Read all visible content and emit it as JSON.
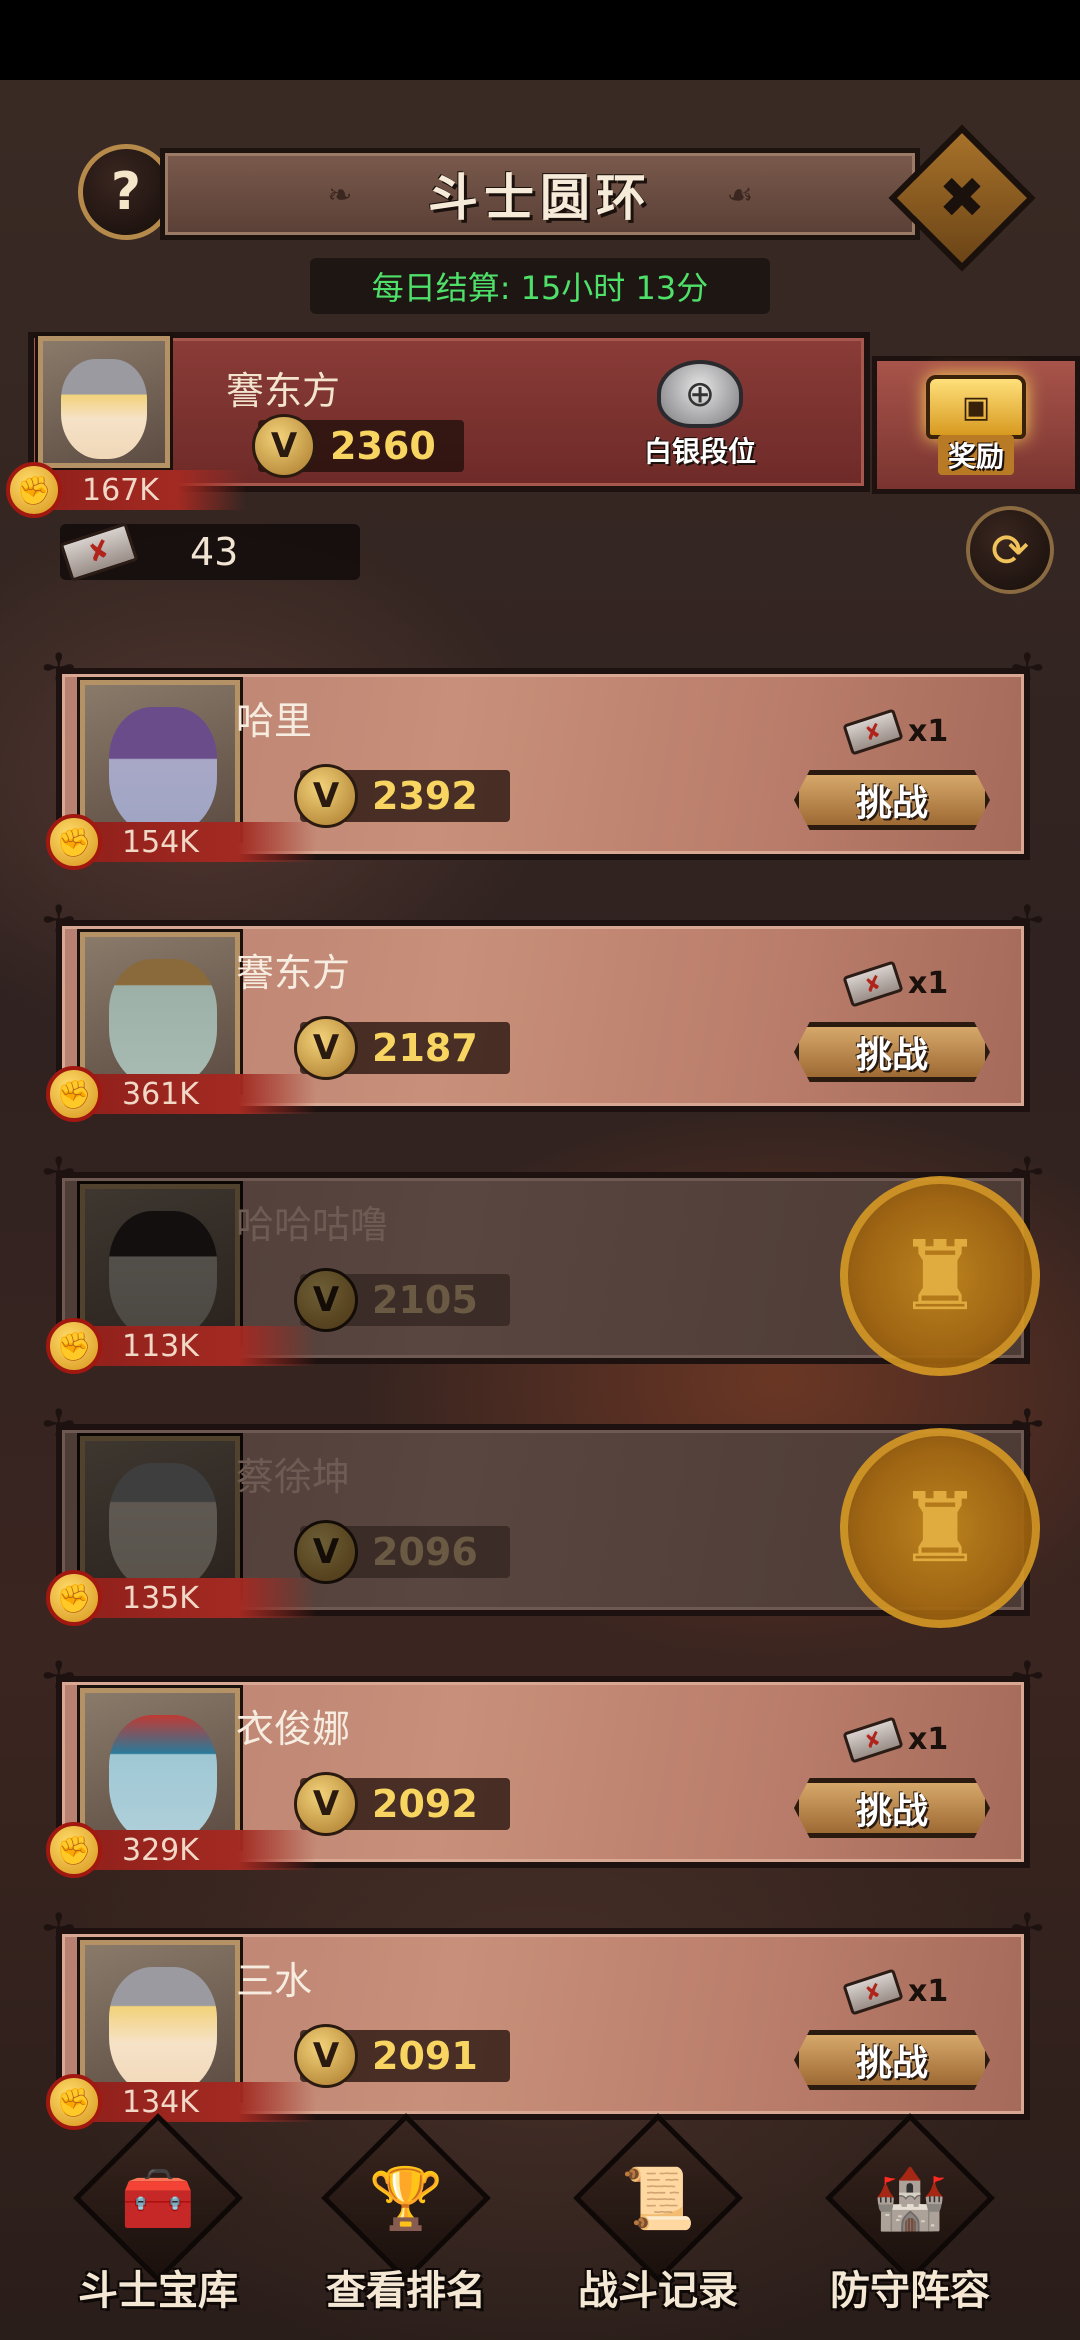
{
  "header": {
    "title": "斗士圆环",
    "help_icon": "?",
    "close_icon": "✖"
  },
  "settlement": {
    "label": "每日结算:",
    "value": "15小时 13分"
  },
  "player": {
    "name": "謇东方",
    "score": "2360",
    "power": "167K",
    "rank_label": "白银段位",
    "reward_label": "奖励",
    "tickets": "43"
  },
  "opponents": [
    {
      "name": "哈里",
      "score": "2392",
      "power": "154K",
      "cost": "x1",
      "action": "挑战",
      "defeated": false
    },
    {
      "name": "謇东方",
      "score": "2187",
      "power": "361K",
      "cost": "x1",
      "action": "挑战",
      "defeated": false
    },
    {
      "name": "哈哈咕噜",
      "score": "2105",
      "power": "113K",
      "defeated": true
    },
    {
      "name": "蔡徐坤",
      "score": "2096",
      "power": "135K",
      "defeated": true
    },
    {
      "name": "衣俊娜",
      "score": "2092",
      "power": "329K",
      "cost": "x1",
      "action": "挑战",
      "defeated": false
    },
    {
      "name": "三水",
      "score": "2091",
      "power": "134K",
      "cost": "x1",
      "action": "挑战",
      "defeated": false
    }
  ],
  "nav": [
    {
      "label": "斗士宝库",
      "icon": "treasure-chest-icon"
    },
    {
      "label": "查看排名",
      "icon": "trophy-icon"
    },
    {
      "label": "战斗记录",
      "icon": "scroll-icon"
    },
    {
      "label": "防守阵容",
      "icon": "castle-shield-icon"
    }
  ],
  "colors": {
    "timer_green": "#4fe06a",
    "score_gold": "#f7d560",
    "banner_red": "#8a3c38"
  }
}
